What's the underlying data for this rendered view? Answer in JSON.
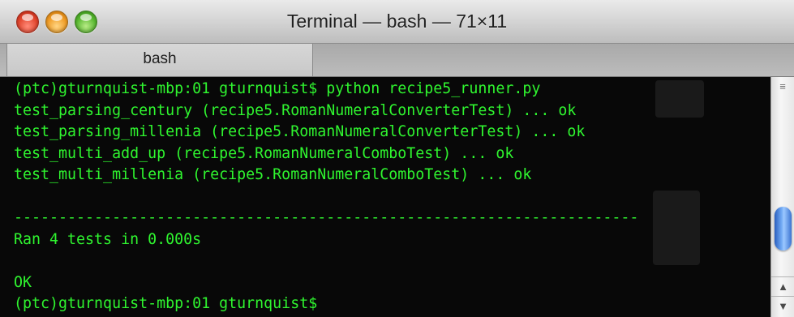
{
  "window": {
    "title": "Terminal — bash — 71×11"
  },
  "tabs": [
    {
      "label": "bash",
      "active": true
    }
  ],
  "terminal": {
    "lines": [
      "(ptc)gturnquist-mbp:01 gturnquist$ python recipe5_runner.py",
      "test_parsing_century (recipe5.RomanNumeralConverterTest) ... ok",
      "test_parsing_millenia (recipe5.RomanNumeralConverterTest) ... ok",
      "test_multi_add_up (recipe5.RomanNumeralComboTest) ... ok",
      "test_multi_millenia (recipe5.RomanNumeralComboTest) ... ok",
      "",
      "----------------------------------------------------------------------",
      "Ran 4 tests in 0.000s",
      "",
      "OK",
      "(ptc)gturnquist-mbp:01 gturnquist$"
    ],
    "text_color": "#2ff52f",
    "background": "#080808"
  },
  "scrollbar": {
    "grip_glyph": "≡",
    "up_arrow": "▲",
    "down_arrow": "▼"
  },
  "colors": {
    "close": "#e2452d",
    "minimize": "#f09c25",
    "zoom": "#58b830",
    "scroll_thumb": "#4b86e0"
  }
}
